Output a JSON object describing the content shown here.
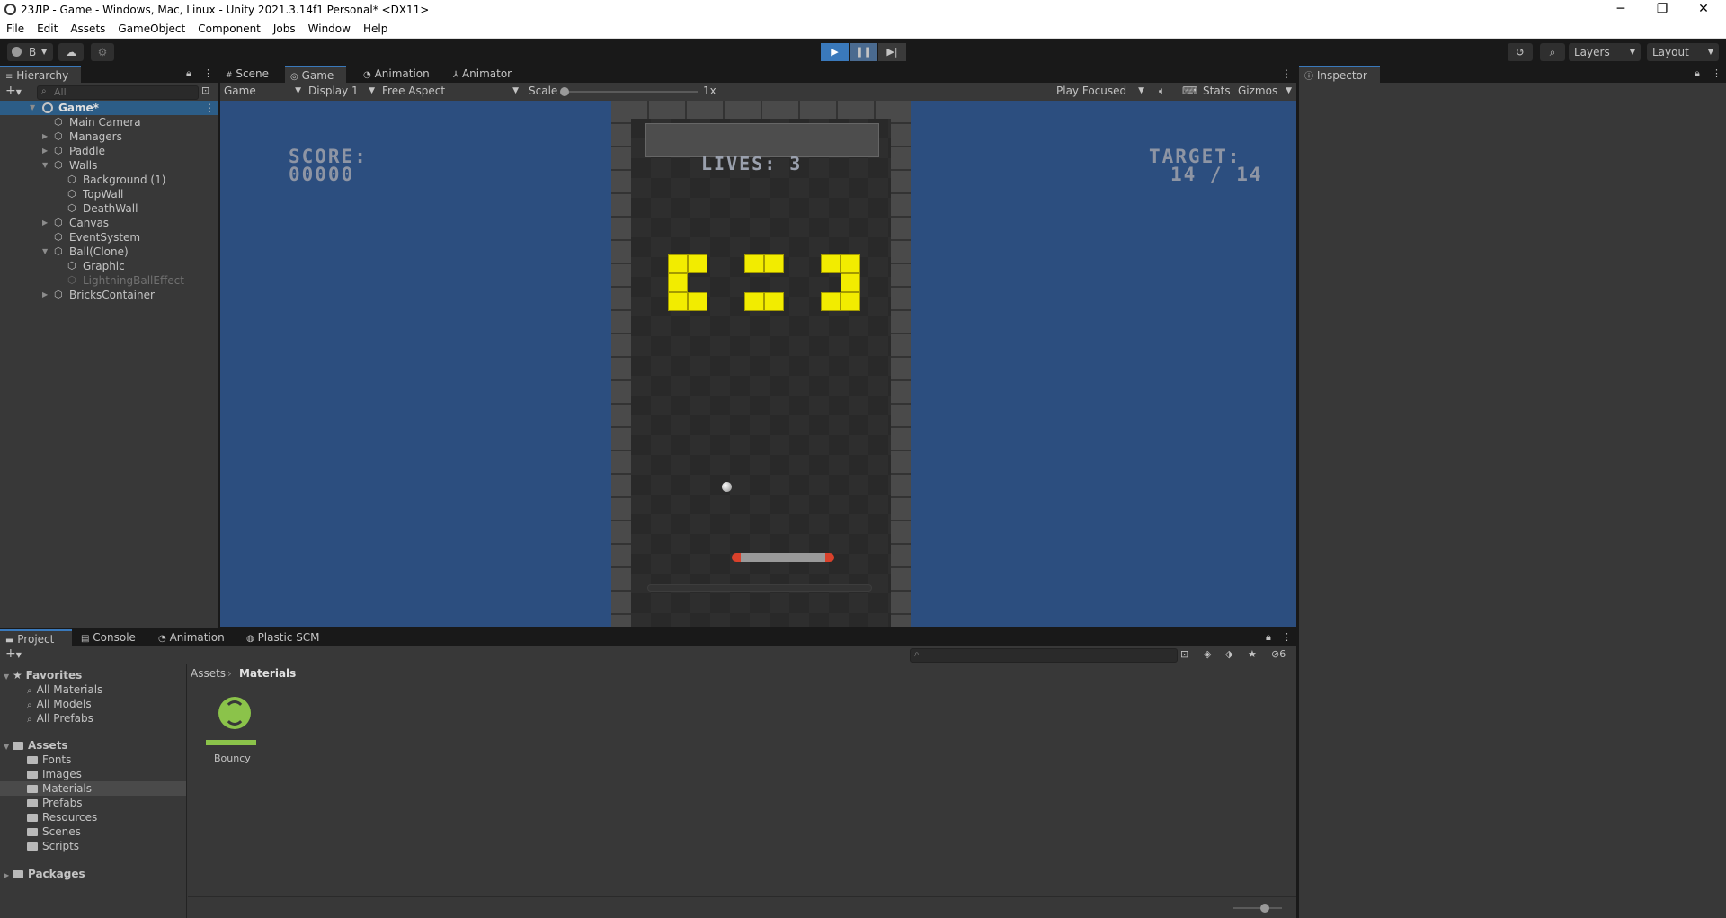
{
  "window": {
    "title": "23ЛР - Game - Windows, Mac, Linux - Unity 2021.3.14f1 Personal* <DX11>",
    "controls": {
      "minimize": "─",
      "maximize": "❐",
      "close": "✕"
    }
  },
  "menu": [
    "File",
    "Edit",
    "Assets",
    "GameObject",
    "Component",
    "Jobs",
    "Window",
    "Help"
  ],
  "toolbar": {
    "account": "B",
    "layers": "Layers",
    "layout": "Layout"
  },
  "hierarchy": {
    "tab": "Hierarchy",
    "search_placeholder": "All",
    "scene": "Game*",
    "items": [
      {
        "label": "Main Camera",
        "depth": 1,
        "arrow": ""
      },
      {
        "label": "Managers",
        "depth": 1,
        "arrow": "▶"
      },
      {
        "label": "Paddle",
        "depth": 1,
        "arrow": "▶"
      },
      {
        "label": "Walls",
        "depth": 1,
        "arrow": "▼"
      },
      {
        "label": "Background (1)",
        "depth": 2,
        "arrow": ""
      },
      {
        "label": "TopWall",
        "depth": 2,
        "arrow": ""
      },
      {
        "label": "DeathWall",
        "depth": 2,
        "arrow": ""
      },
      {
        "label": "Canvas",
        "depth": 1,
        "arrow": "▶"
      },
      {
        "label": "EventSystem",
        "depth": 1,
        "arrow": ""
      },
      {
        "label": "Ball(Clone)",
        "depth": 1,
        "arrow": "▼"
      },
      {
        "label": "Graphic",
        "depth": 2,
        "arrow": ""
      },
      {
        "label": "LightningBallEffect",
        "depth": 2,
        "arrow": "",
        "disabled": true
      },
      {
        "label": "BricksContainer",
        "depth": 1,
        "arrow": "▶"
      }
    ]
  },
  "center_tabs": [
    "Scene",
    "Game",
    "Animation",
    "Animator"
  ],
  "game_toolbar": {
    "view": "Game",
    "display": "Display 1",
    "aspect": "Free Aspect",
    "scale_label": "Scale",
    "scale_value": "1x",
    "play_mode": "Play Focused",
    "stats": "Stats",
    "gizmos": "Gizmos"
  },
  "game": {
    "score_label": "SCORE:",
    "score_value": "00000",
    "lives": "LIVES: 3",
    "target_label": "TARGET:",
    "target_value": "14 / 14"
  },
  "inspector": {
    "tab": "Inspector"
  },
  "bottom_tabs": [
    "Project",
    "Console",
    "Animation",
    "Plastic SCM"
  ],
  "project": {
    "hidden_count": "6",
    "favorites": {
      "label": "Favorites",
      "items": [
        "All Materials",
        "All Models",
        "All Prefabs"
      ]
    },
    "assets": {
      "label": "Assets",
      "items": [
        "Fonts",
        "Images",
        "Materials",
        "Prefabs",
        "Resources",
        "Scenes",
        "Scripts"
      ]
    },
    "packages": "Packages",
    "breadcrumb": [
      "Assets",
      "Materials"
    ],
    "files": [
      {
        "name": "Bouncy",
        "color": "#8bc34a"
      }
    ]
  },
  "colors": {
    "accent": "#3a79bb",
    "game_bg": "#2c4e7f",
    "brick": "#f2ec00",
    "paddle": "#d9412b"
  }
}
